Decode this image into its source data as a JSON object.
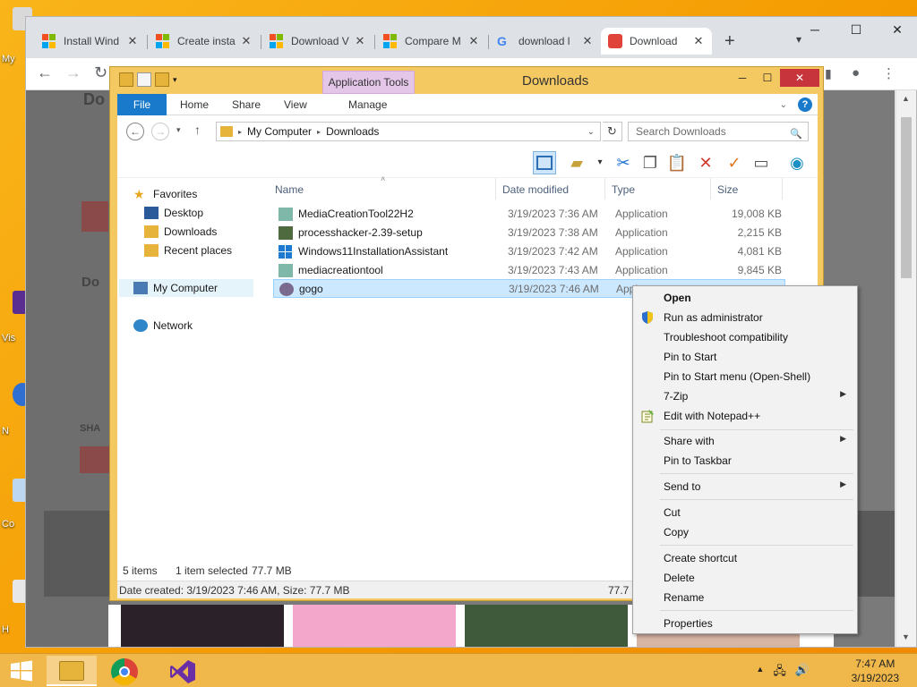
{
  "desktop": {
    "labels": [
      "My",
      "Vis",
      "N",
      "Co",
      "H"
    ]
  },
  "browser": {
    "tabs": [
      {
        "title": "Install Wind",
        "icon": "microsoft-logo"
      },
      {
        "title": "Create insta",
        "icon": "microsoft-logo"
      },
      {
        "title": "Download V",
        "icon": "microsoft-logo"
      },
      {
        "title": "Compare M",
        "icon": "microsoft-logo"
      },
      {
        "title": "download l",
        "icon": "google-logo"
      },
      {
        "title": "Download",
        "icon": "download-site-icon"
      }
    ],
    "page_letters": [
      "Do",
      "Do",
      "SHA"
    ]
  },
  "explorer": {
    "title": "Downloads",
    "context_tab": "Application Tools",
    "ribbon_tabs": [
      "File",
      "Home",
      "Share",
      "View",
      "Manage"
    ],
    "address": {
      "root": "My Computer",
      "folder": "Downloads"
    },
    "search_placeholder": "Search Downloads",
    "nav": {
      "favorites": "Favorites",
      "desktop": "Desktop",
      "downloads": "Downloads",
      "recent": "Recent places",
      "my_computer": "My Computer",
      "network": "Network"
    },
    "columns": {
      "name": "Name",
      "date": "Date modified",
      "type": "Type",
      "size": "Size"
    },
    "files": [
      {
        "name": "MediaCreationTool22H2",
        "date": "3/19/2023 7:36 AM",
        "type": "Application",
        "size": "19,008 KB"
      },
      {
        "name": "processhacker-2.39-setup",
        "date": "3/19/2023 7:38 AM",
        "type": "Application",
        "size": "2,215 KB"
      },
      {
        "name": "Windows11InstallationAssistant",
        "date": "3/19/2023 7:42 AM",
        "type": "Application",
        "size": "4,081 KB"
      },
      {
        "name": "mediacreationtool",
        "date": "3/19/2023 7:43 AM",
        "type": "Application",
        "size": "9,845 KB"
      },
      {
        "name": "gogo",
        "date": "3/19/2023 7:46 AM",
        "type": "Appl",
        "size": ""
      }
    ],
    "status": {
      "items": "5 items",
      "selected": "1 item selected",
      "sel_size": "77.7 MB"
    },
    "details": {
      "text": "Date created: 3/19/2023 7:46 AM, Size: 77.7 MB",
      "right": "77.7"
    }
  },
  "context_menu": {
    "items": [
      {
        "label": "Open",
        "bold": true
      },
      {
        "label": "Run as administrator",
        "icon": "uac-shield-icon"
      },
      {
        "label": "Troubleshoot compatibility"
      },
      {
        "label": "Pin to Start"
      },
      {
        "label": "Pin to Start menu (Open-Shell)"
      },
      {
        "label": "7-Zip",
        "submenu": true
      },
      {
        "label": "Edit with Notepad++",
        "icon": "notepadpp-icon"
      },
      {
        "label": "Share with",
        "submenu": true
      },
      {
        "label": "Pin to Taskbar"
      },
      {
        "label": "Send to",
        "submenu": true
      },
      {
        "label": "Cut"
      },
      {
        "label": "Copy"
      },
      {
        "label": "Create shortcut"
      },
      {
        "label": "Delete"
      },
      {
        "label": "Rename"
      },
      {
        "label": "Properties"
      }
    ]
  },
  "taskbar": {
    "time": "7:47 AM",
    "date": "3/19/2023"
  },
  "colors": {
    "desktop": "#f6a600",
    "ribbon_file": "#1979ca",
    "selection": "#cce8ff",
    "close_button": "#c7343b",
    "app_tools": "#e4c6e9"
  }
}
